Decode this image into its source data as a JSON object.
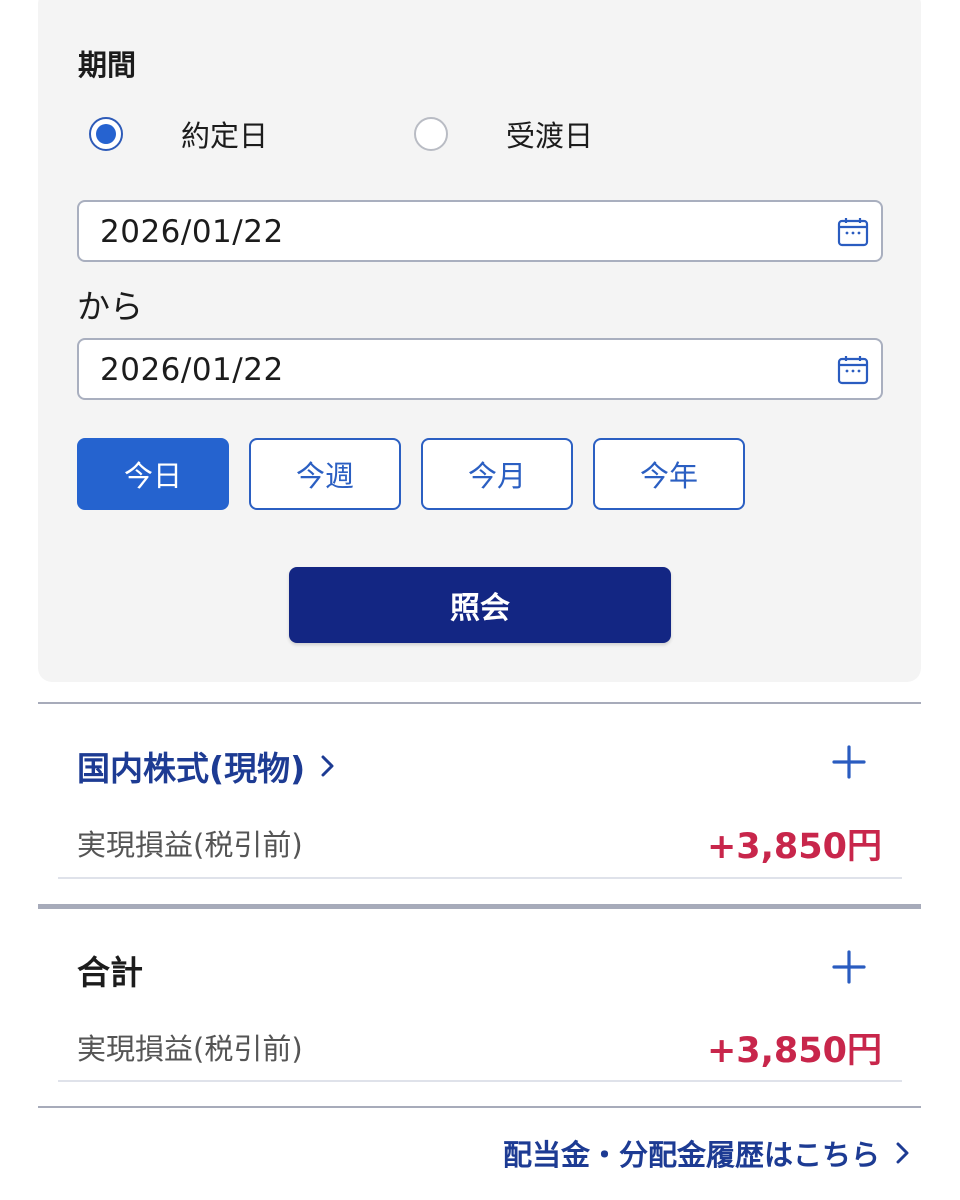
{
  "search": {
    "title": "期間",
    "radio": [
      {
        "label": "約定日",
        "checked": true
      },
      {
        "label": "受渡日",
        "checked": false
      }
    ],
    "from_date": "2026/01/22",
    "separator": "から",
    "to_date": "2026/01/22",
    "period_buttons": [
      {
        "label": "今日",
        "active": true
      },
      {
        "label": "今週",
        "active": false
      },
      {
        "label": "今月",
        "active": false
      },
      {
        "label": "今年",
        "active": false
      }
    ],
    "submit_label": "照会"
  },
  "domestic": {
    "title": "国内株式(現物)",
    "row_label": "実現損益(税引前)",
    "row_value": "+3,850円"
  },
  "total": {
    "title": "合計",
    "row_label": "実現損益(税引前)",
    "row_value": "+3,850円"
  },
  "footer": {
    "link_label": "配当金・分配金履歴はこちら"
  },
  "colors": {
    "accent": "#2563cf",
    "navy": "#132683",
    "profit": "#c8264b"
  },
  "icons": [
    "calendar-icon",
    "chevron-right-icon",
    "plus-icon"
  ]
}
